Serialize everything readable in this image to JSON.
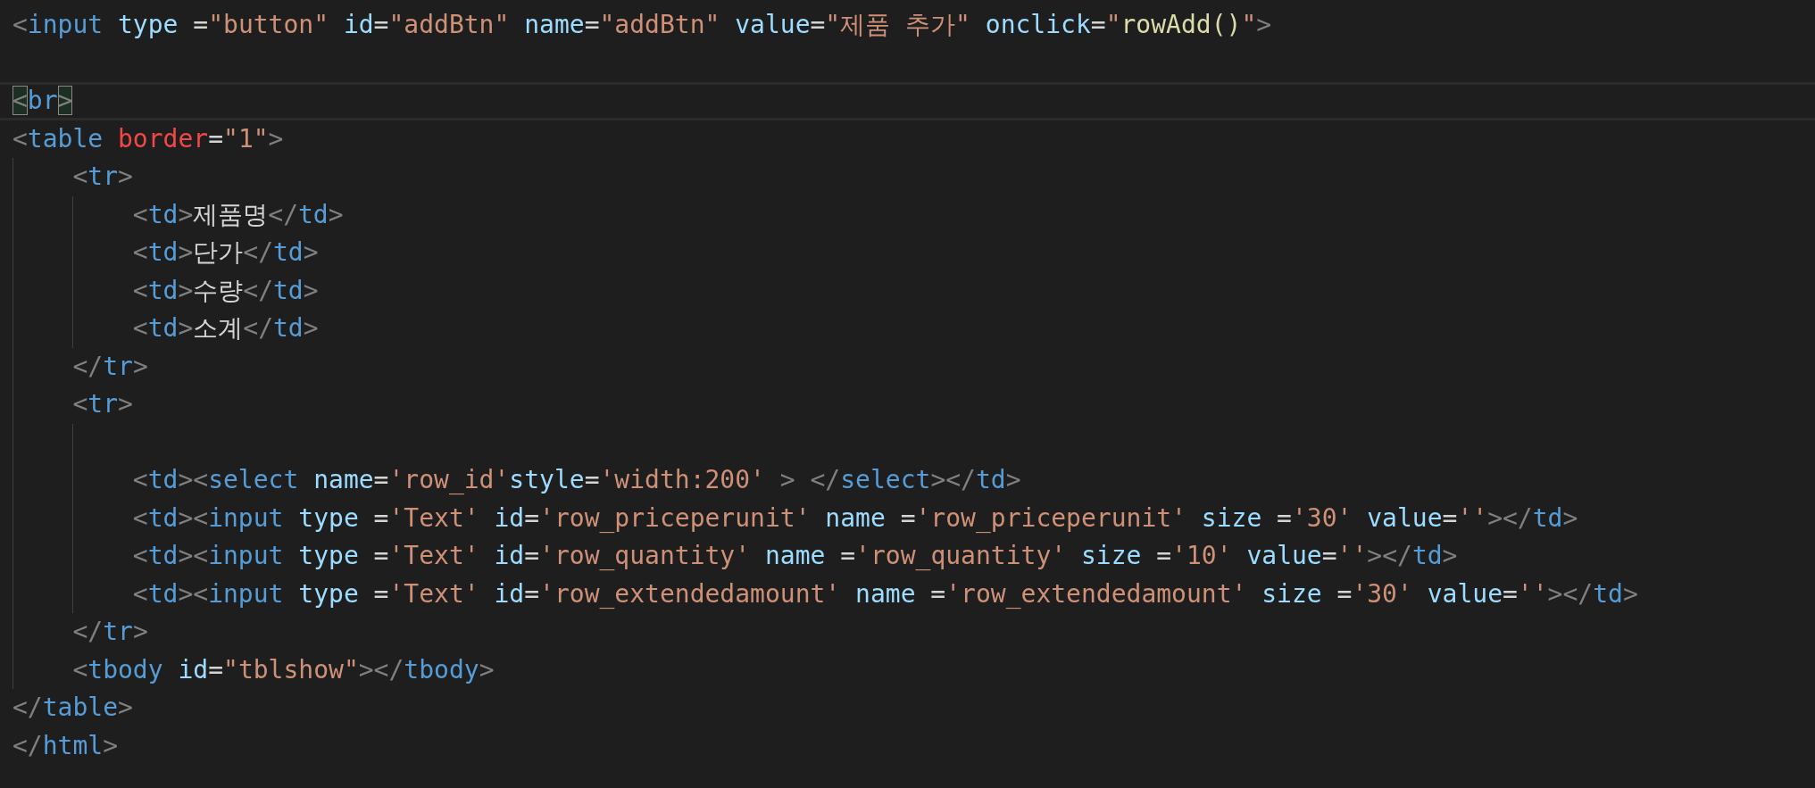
{
  "editor": {
    "lines": [
      {
        "current": false,
        "tokens": [
          {
            "kind": "p",
            "text": "<"
          },
          {
            "kind": "tag",
            "text": "input"
          },
          {
            "kind": "attr",
            "text": " type"
          },
          {
            "kind": "text",
            "text": " ="
          },
          {
            "kind": "str",
            "text": "\"button\""
          },
          {
            "kind": "attr",
            "text": " id"
          },
          {
            "kind": "text",
            "text": "="
          },
          {
            "kind": "str",
            "text": "\"addBtn\""
          },
          {
            "kind": "attr",
            "text": " name"
          },
          {
            "kind": "text",
            "text": "="
          },
          {
            "kind": "str",
            "text": "\"addBtn\""
          },
          {
            "kind": "attr",
            "text": " value"
          },
          {
            "kind": "text",
            "text": "="
          },
          {
            "kind": "str",
            "text": "\"제품 추가\""
          },
          {
            "kind": "attr",
            "text": " onclick"
          },
          {
            "kind": "text",
            "text": "="
          },
          {
            "kind": "str",
            "text": "\""
          },
          {
            "kind": "fn",
            "text": "rowAdd()"
          },
          {
            "kind": "str",
            "text": "\""
          },
          {
            "kind": "p",
            "text": ">"
          }
        ]
      },
      {
        "current": false
      },
      {
        "current": true,
        "tokens": [
          {
            "kind": "match",
            "text": "<"
          },
          {
            "kind": "tag",
            "text": "br"
          },
          {
            "kind": "match",
            "text": ">"
          }
        ]
      },
      {
        "current": false,
        "tokens": [
          {
            "kind": "p",
            "text": "<"
          },
          {
            "kind": "tag",
            "text": "table"
          },
          {
            "kind": "bad",
            "text": " border"
          },
          {
            "kind": "text",
            "text": "="
          },
          {
            "kind": "str",
            "text": "\"1\""
          },
          {
            "kind": "p",
            "text": ">"
          }
        ]
      },
      {
        "current": false,
        "tokens": [
          {
            "kind": "p",
            "text": "    <"
          },
          {
            "kind": "tag",
            "text": "tr"
          },
          {
            "kind": "p",
            "text": ">"
          }
        ]
      },
      {
        "current": false,
        "tokens": [
          {
            "kind": "p",
            "text": "        <"
          },
          {
            "kind": "tag",
            "text": "td"
          },
          {
            "kind": "p",
            "text": ">"
          },
          {
            "kind": "text",
            "text": "제품명"
          },
          {
            "kind": "p",
            "text": "</"
          },
          {
            "kind": "tag",
            "text": "td"
          },
          {
            "kind": "p",
            "text": ">"
          }
        ]
      },
      {
        "current": false,
        "tokens": [
          {
            "kind": "p",
            "text": "        <"
          },
          {
            "kind": "tag",
            "text": "td"
          },
          {
            "kind": "p",
            "text": ">"
          },
          {
            "kind": "text",
            "text": "단가"
          },
          {
            "kind": "p",
            "text": "</"
          },
          {
            "kind": "tag",
            "text": "td"
          },
          {
            "kind": "p",
            "text": ">"
          }
        ]
      },
      {
        "current": false,
        "tokens": [
          {
            "kind": "p",
            "text": "        <"
          },
          {
            "kind": "tag",
            "text": "td"
          },
          {
            "kind": "p",
            "text": ">"
          },
          {
            "kind": "text",
            "text": "수량"
          },
          {
            "kind": "p",
            "text": "</"
          },
          {
            "kind": "tag",
            "text": "td"
          },
          {
            "kind": "p",
            "text": ">"
          }
        ]
      },
      {
        "current": false,
        "tokens": [
          {
            "kind": "p",
            "text": "        <"
          },
          {
            "kind": "tag",
            "text": "td"
          },
          {
            "kind": "p",
            "text": ">"
          },
          {
            "kind": "text",
            "text": "소계"
          },
          {
            "kind": "p",
            "text": "</"
          },
          {
            "kind": "tag",
            "text": "td"
          },
          {
            "kind": "p",
            "text": ">"
          }
        ]
      },
      {
        "current": false,
        "tokens": [
          {
            "kind": "p",
            "text": "    </"
          },
          {
            "kind": "tag",
            "text": "tr"
          },
          {
            "kind": "p",
            "text": ">"
          }
        ]
      },
      {
        "current": false,
        "tokens": [
          {
            "kind": "p",
            "text": "    <"
          },
          {
            "kind": "tag",
            "text": "tr"
          },
          {
            "kind": "p",
            "text": ">"
          }
        ]
      },
      {
        "current": false
      },
      {
        "current": false,
        "tokens": [
          {
            "kind": "p",
            "text": "        <"
          },
          {
            "kind": "tag",
            "text": "td"
          },
          {
            "kind": "p",
            "text": "><"
          },
          {
            "kind": "tag",
            "text": "select"
          },
          {
            "kind": "attr",
            "text": " name"
          },
          {
            "kind": "text",
            "text": "="
          },
          {
            "kind": "str",
            "text": "'row_id'"
          },
          {
            "kind": "attr",
            "text": "style"
          },
          {
            "kind": "text",
            "text": "="
          },
          {
            "kind": "str",
            "text": "'width:200'"
          },
          {
            "kind": "p",
            "text": " > </"
          },
          {
            "kind": "tag",
            "text": "select"
          },
          {
            "kind": "p",
            "text": "></"
          },
          {
            "kind": "tag",
            "text": "td"
          },
          {
            "kind": "p",
            "text": ">"
          }
        ]
      },
      {
        "current": false,
        "tokens": [
          {
            "kind": "p",
            "text": "        <"
          },
          {
            "kind": "tag",
            "text": "td"
          },
          {
            "kind": "p",
            "text": "><"
          },
          {
            "kind": "tag",
            "text": "input"
          },
          {
            "kind": "attr",
            "text": " type"
          },
          {
            "kind": "text",
            "text": " ="
          },
          {
            "kind": "str",
            "text": "'Text'"
          },
          {
            "kind": "attr",
            "text": " id"
          },
          {
            "kind": "text",
            "text": "="
          },
          {
            "kind": "str",
            "text": "'row_priceperunit'"
          },
          {
            "kind": "attr",
            "text": " name"
          },
          {
            "kind": "text",
            "text": " ="
          },
          {
            "kind": "str",
            "text": "'row_priceperunit'"
          },
          {
            "kind": "attr",
            "text": " size"
          },
          {
            "kind": "text",
            "text": " ="
          },
          {
            "kind": "str",
            "text": "'30'"
          },
          {
            "kind": "attr",
            "text": " value"
          },
          {
            "kind": "text",
            "text": "="
          },
          {
            "kind": "str",
            "text": "''"
          },
          {
            "kind": "p",
            "text": "></"
          },
          {
            "kind": "tag",
            "text": "td"
          },
          {
            "kind": "p",
            "text": ">"
          }
        ]
      },
      {
        "current": false,
        "tokens": [
          {
            "kind": "p",
            "text": "        <"
          },
          {
            "kind": "tag",
            "text": "td"
          },
          {
            "kind": "p",
            "text": "><"
          },
          {
            "kind": "tag",
            "text": "input"
          },
          {
            "kind": "attr",
            "text": " type"
          },
          {
            "kind": "text",
            "text": " ="
          },
          {
            "kind": "str",
            "text": "'Text'"
          },
          {
            "kind": "attr",
            "text": " id"
          },
          {
            "kind": "text",
            "text": "="
          },
          {
            "kind": "str",
            "text": "'row_quantity'"
          },
          {
            "kind": "attr",
            "text": " name"
          },
          {
            "kind": "text",
            "text": " ="
          },
          {
            "kind": "str",
            "text": "'row_quantity'"
          },
          {
            "kind": "attr",
            "text": " size"
          },
          {
            "kind": "text",
            "text": " ="
          },
          {
            "kind": "str",
            "text": "'10'"
          },
          {
            "kind": "attr",
            "text": " value"
          },
          {
            "kind": "text",
            "text": "="
          },
          {
            "kind": "str",
            "text": "''"
          },
          {
            "kind": "p",
            "text": "></"
          },
          {
            "kind": "tag",
            "text": "td"
          },
          {
            "kind": "p",
            "text": ">"
          }
        ]
      },
      {
        "current": false,
        "tokens": [
          {
            "kind": "p",
            "text": "        <"
          },
          {
            "kind": "tag",
            "text": "td"
          },
          {
            "kind": "p",
            "text": "><"
          },
          {
            "kind": "tag",
            "text": "input"
          },
          {
            "kind": "attr",
            "text": " type"
          },
          {
            "kind": "text",
            "text": " ="
          },
          {
            "kind": "str",
            "text": "'Text'"
          },
          {
            "kind": "attr",
            "text": " id"
          },
          {
            "kind": "text",
            "text": "="
          },
          {
            "kind": "str",
            "text": "'row_extendedamount'"
          },
          {
            "kind": "attr",
            "text": " name"
          },
          {
            "kind": "text",
            "text": " ="
          },
          {
            "kind": "str",
            "text": "'row_extendedamount'"
          },
          {
            "kind": "attr",
            "text": " size"
          },
          {
            "kind": "text",
            "text": " ="
          },
          {
            "kind": "str",
            "text": "'30'"
          },
          {
            "kind": "attr",
            "text": " value"
          },
          {
            "kind": "text",
            "text": "="
          },
          {
            "kind": "str",
            "text": "''"
          },
          {
            "kind": "p",
            "text": "></"
          },
          {
            "kind": "tag",
            "text": "td"
          },
          {
            "kind": "p",
            "text": ">"
          }
        ]
      },
      {
        "current": false,
        "tokens": [
          {
            "kind": "p",
            "text": "    </"
          },
          {
            "kind": "tag",
            "text": "tr"
          },
          {
            "kind": "p",
            "text": ">"
          }
        ]
      },
      {
        "current": false,
        "tokens": [
          {
            "kind": "p",
            "text": "    <"
          },
          {
            "kind": "tag",
            "text": "tbody"
          },
          {
            "kind": "attr",
            "text": " id"
          },
          {
            "kind": "text",
            "text": "="
          },
          {
            "kind": "str",
            "text": "\"tblshow\""
          },
          {
            "kind": "p",
            "text": "></"
          },
          {
            "kind": "tag",
            "text": "tbody"
          },
          {
            "kind": "p",
            "text": ">"
          }
        ]
      },
      {
        "current": false,
        "tokens": [
          {
            "kind": "p",
            "text": "</"
          },
          {
            "kind": "tag",
            "text": "table"
          },
          {
            "kind": "p",
            "text": ">"
          }
        ]
      },
      {
        "current": false,
        "tokens": [
          {
            "kind": "p",
            "text": "</"
          },
          {
            "kind": "tag",
            "text": "html"
          },
          {
            "kind": "p",
            "text": ">"
          }
        ]
      }
    ]
  }
}
